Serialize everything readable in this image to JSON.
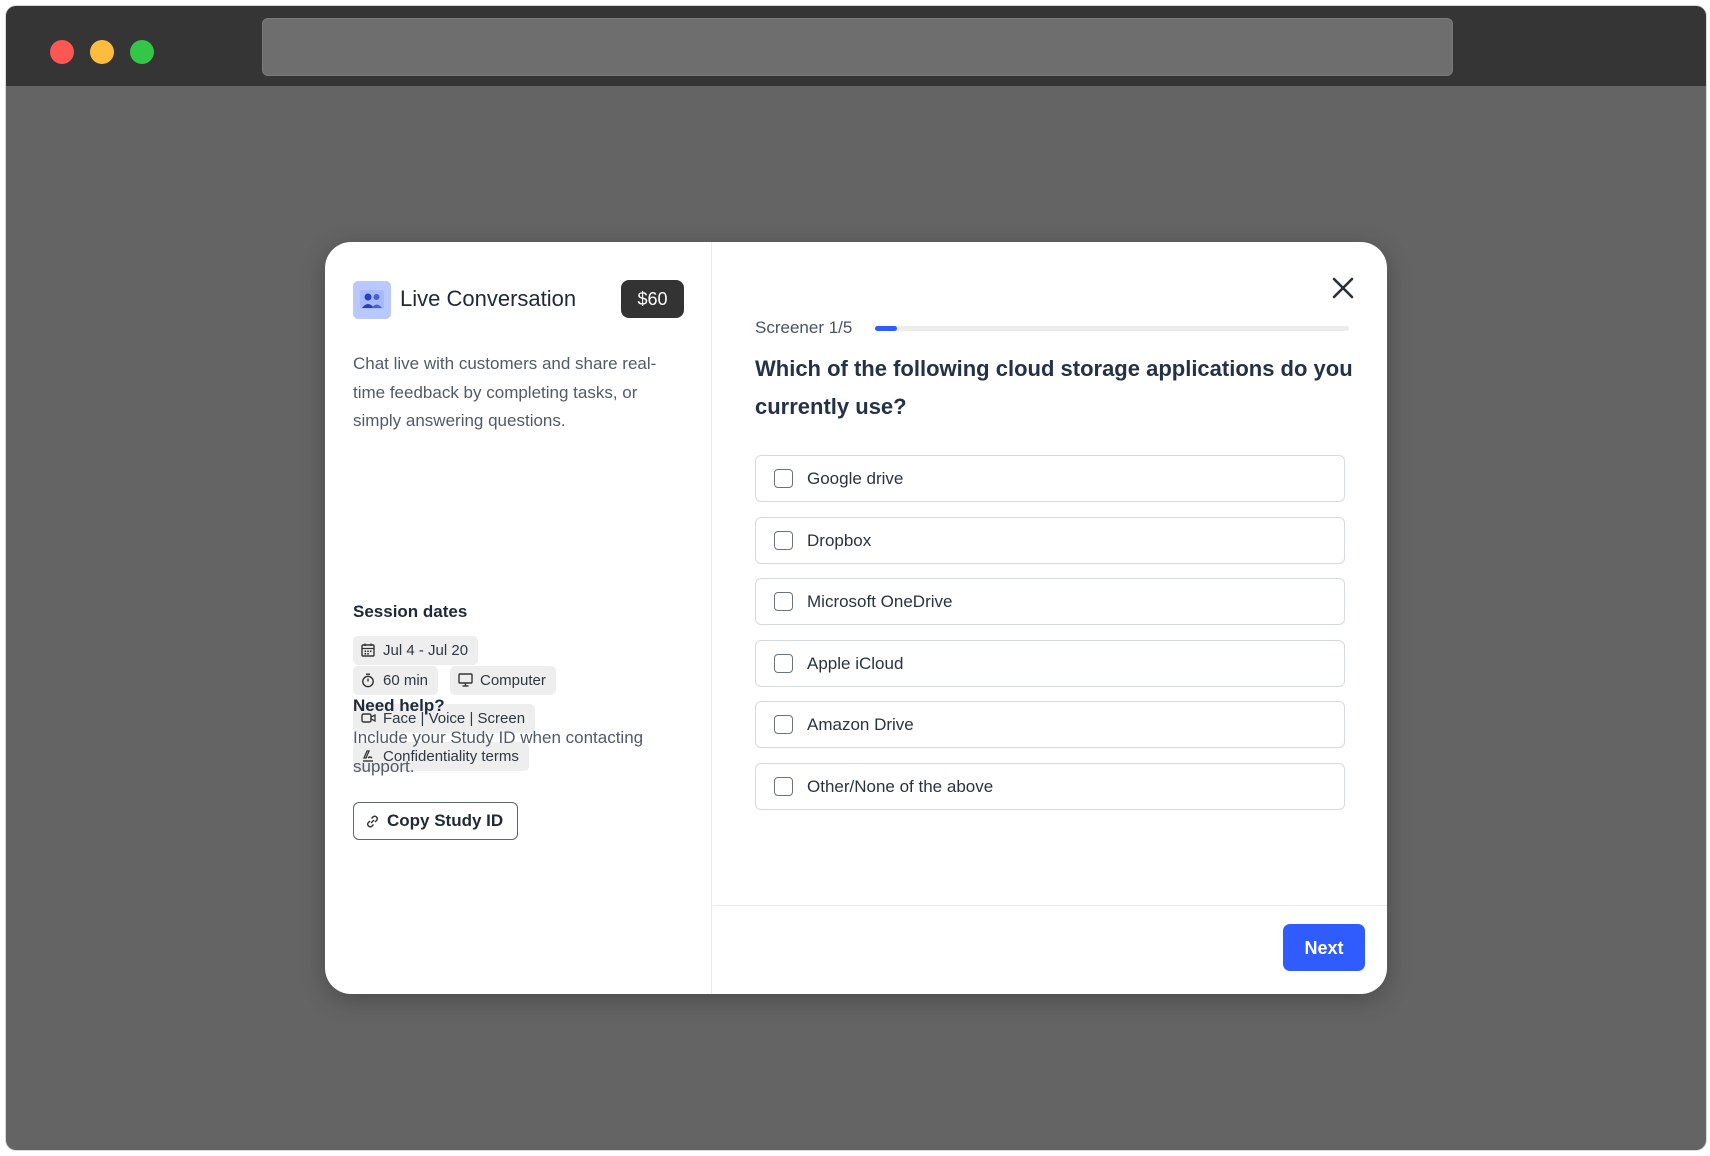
{
  "study": {
    "title": "Live Conversation",
    "price": "$60",
    "icon": "users-video-icon",
    "description": "Chat live with customers and share real-time feedback by completing tasks, or simply answering questions."
  },
  "chips": {
    "duration": "60 min",
    "device": "Computer",
    "recording": "Face | Voice | Screen",
    "confidentiality": "Confidentiality terms"
  },
  "session": {
    "heading": "Session dates",
    "dates": "Jul 4 - Jul 20"
  },
  "help": {
    "heading": "Need help?",
    "text": "Include your Study ID when contacting support.",
    "copy_label": "Copy Study ID"
  },
  "screener": {
    "label": "Screener 1/5",
    "progress": 0.2,
    "question": "Which of the following cloud storage applications do you currently use?",
    "options": [
      "Google drive",
      "Dropbox",
      "Microsoft OneDrive",
      "Apple iCloud",
      "Amazon Drive",
      "Other/None of the above"
    ],
    "next_label": "Next"
  },
  "colors": {
    "accent": "#2f5bff",
    "badge": "#333333",
    "study_icon_bg": "#b9c8ff"
  }
}
